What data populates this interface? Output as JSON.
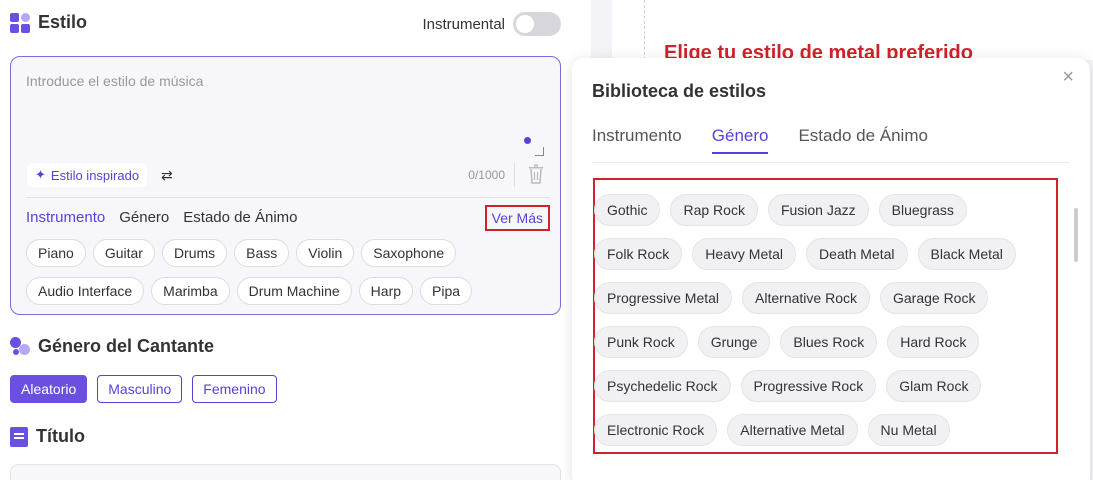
{
  "style_section": {
    "title": "Estilo",
    "instrumental_label": "Instrumental",
    "placeholder": "Introduce el estilo de música",
    "inspired_label": "Estilo inspirado",
    "counter": "0/1000",
    "tabs": [
      "Instrumento",
      "Género",
      "Estado de Ánimo"
    ],
    "ver_mas": "Ver Más",
    "instruments_row1": [
      "Piano",
      "Guitar",
      "Drums",
      "Bass",
      "Violin",
      "Saxophone"
    ],
    "instruments_row2": [
      "Audio Interface",
      "Marimba",
      "Drum Machine",
      "Harp",
      "Pipa"
    ]
  },
  "gender_section": {
    "title": "Género del Cantante",
    "options": [
      "Aleatorio",
      "Masculino",
      "Femenino"
    ],
    "selected": "Aleatorio"
  },
  "title_section": {
    "title": "Título"
  },
  "annotation": "Elige tu estilo de metal preferido",
  "modal": {
    "title": "Biblioteca de estilos",
    "close": "×",
    "tabs": [
      "Instrumento",
      "Género",
      "Estado de Ánimo"
    ],
    "active_tab": "Género",
    "rows": [
      [
        "Gothic",
        "Rap Rock",
        "Fusion Jazz",
        "Bluegrass"
      ],
      [
        "Folk Rock",
        "Heavy Metal",
        "Death Metal",
        "Black Metal"
      ],
      [
        "Progressive Metal",
        "Alternative Rock",
        "Garage Rock"
      ],
      [
        "Punk Rock",
        "Grunge",
        "Blues Rock",
        "Hard Rock"
      ],
      [
        "Psychedelic Rock",
        "Progressive Rock",
        "Glam Rock"
      ],
      [
        "Electronic Rock",
        "Alternative Metal",
        "Nu Metal"
      ]
    ]
  },
  "colors": {
    "accent": "#5b3fd9",
    "highlight": "#d0222b"
  }
}
